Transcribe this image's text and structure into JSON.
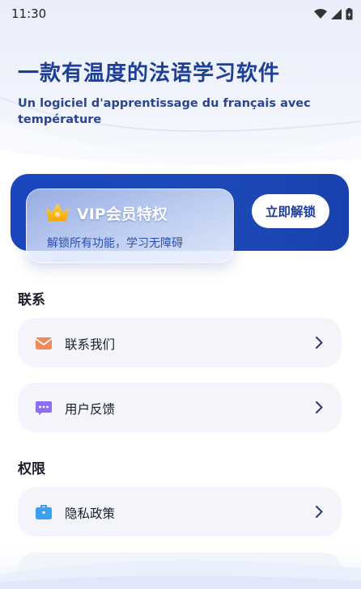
{
  "status_bar": {
    "time": "11:30",
    "icons": [
      "wifi-icon",
      "signal-icon",
      "battery-icon"
    ]
  },
  "hero": {
    "title": "一款有温度的法语学习软件",
    "subtitle": "Un logiciel d'apprentissage du français avec température"
  },
  "vip": {
    "title": "VIP会员特权",
    "description": "解锁所有功能，学习无障碍",
    "unlock_label": "立即解锁",
    "icon": "crown-icon"
  },
  "sections": [
    {
      "label": "联系",
      "items": [
        {
          "label": "联系我们",
          "icon": "mail-icon"
        },
        {
          "label": "用户反馈",
          "icon": "chat-icon"
        }
      ]
    },
    {
      "label": "权限",
      "items": [
        {
          "label": "隐私政策",
          "icon": "briefcase-icon"
        }
      ]
    }
  ],
  "colors": {
    "brand_blue": "#1a47bf",
    "title_blue": "#1e3f96",
    "item_bg": "#f3f5fb"
  }
}
